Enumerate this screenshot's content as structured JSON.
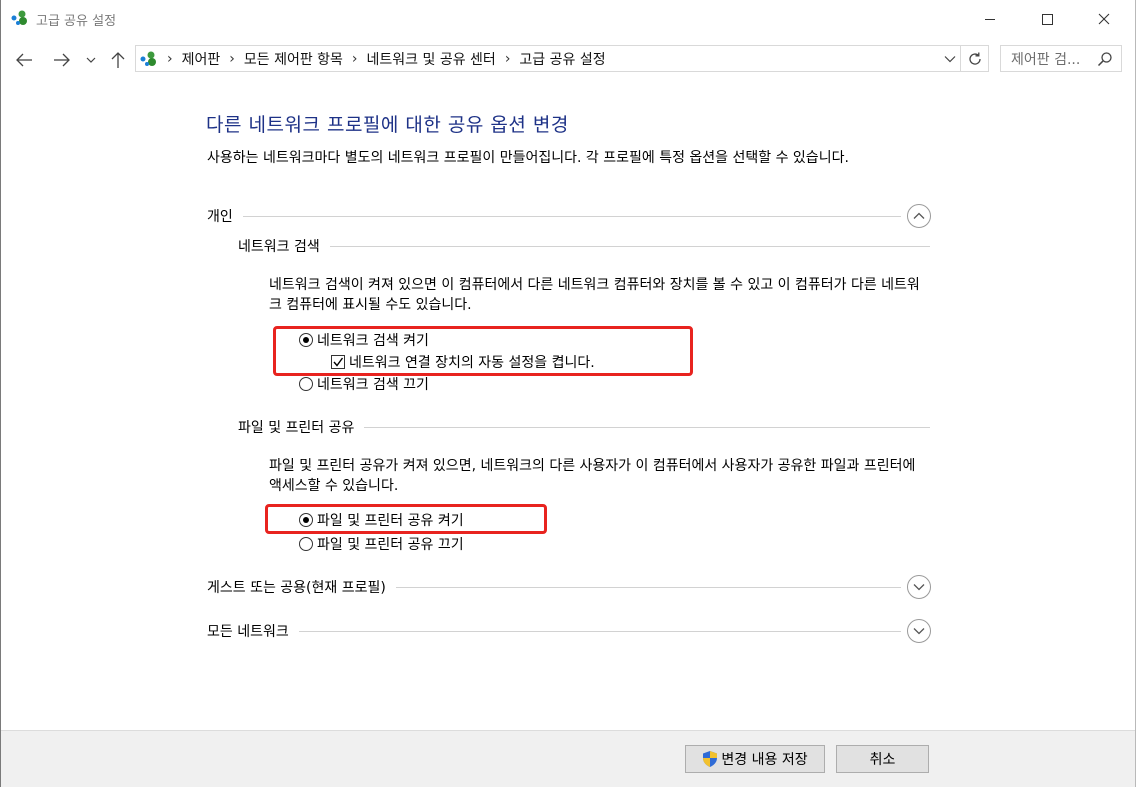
{
  "window": {
    "title": "고급 공유 설정"
  },
  "address": {
    "crumbs": [
      "제어판",
      "모든 제어판 항목",
      "네트워크 및 공유 센터",
      "고급 공유 설정"
    ],
    "search_placeholder": "제어판 검..."
  },
  "main": {
    "title": "다른 네트워크 프로필에 대한 공유 옵션 변경",
    "intro": "사용하는 네트워크마다 별도의 네트워크 프로필이 만들어집니다. 각 프로필에 특정 옵션을 선택할 수 있습니다."
  },
  "private": {
    "label": "개인",
    "discovery": {
      "label": "네트워크 검색",
      "description": "네트워크 검색이 켜져 있으면 이 컴퓨터에서 다른 네트워크 컴퓨터와 장치를 볼 수 있고 이 컴퓨터가 다른 네트워크 컴퓨터에 표시될 수도 있습니다.",
      "on_label": "네트워크 검색 켜기",
      "auto_setup_label": "네트워크 연결 장치의 자동 설정을 켭니다.",
      "off_label": "네트워크 검색 끄기",
      "selected": "on",
      "auto_setup_checked": true
    },
    "sharing": {
      "label": "파일 및 프린터 공유",
      "description": "파일 및 프린터 공유가 켜져 있으면, 네트워크의 다른 사용자가 이 컴퓨터에서 사용자가 공유한 파일과 프린터에 액세스할 수 있습니다.",
      "on_label": "파일 및 프린터 공유 켜기",
      "off_label": "파일 및 프린터 공유 끄기",
      "selected": "on"
    }
  },
  "guest": {
    "label": "게스트 또는 공용(현재 프로필)"
  },
  "all_networks": {
    "label": "모든 네트워크"
  },
  "footer": {
    "save_label": "변경 내용 저장",
    "cancel_label": "취소"
  },
  "colors": {
    "title_blue": "#1e3287",
    "highlight_red": "#e8231f"
  }
}
